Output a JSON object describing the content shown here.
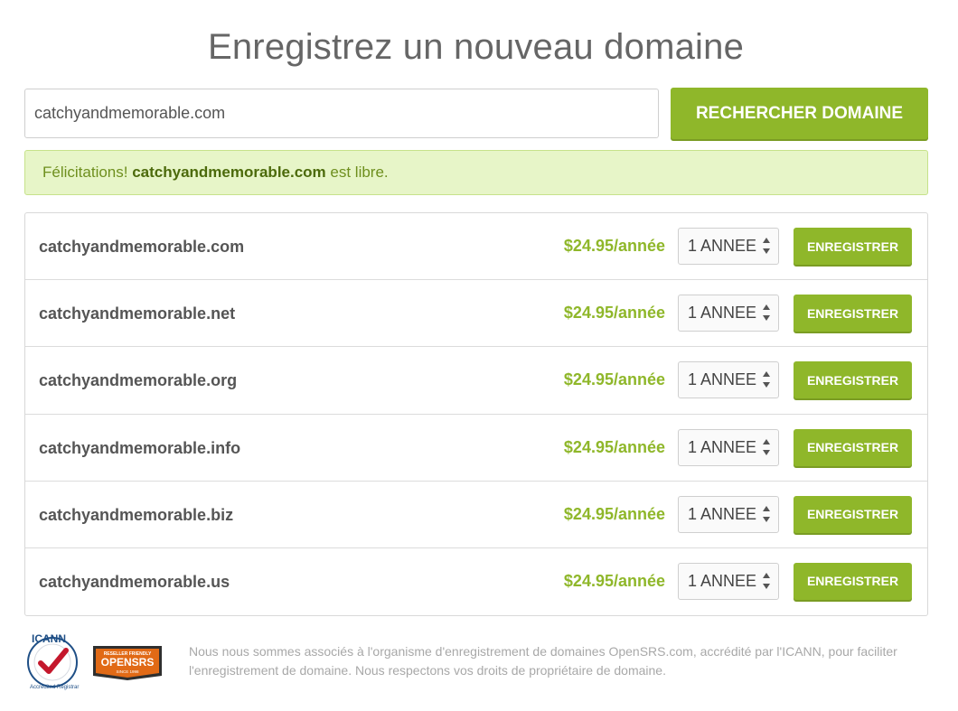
{
  "page": {
    "title": "Enregistrez un nouveau domaine"
  },
  "search": {
    "value": "catchyandmemorable.com",
    "button_label": "RECHERCHER DOMAINE"
  },
  "alert": {
    "prefix": "Félicitations! ",
    "domain": "catchyandmemorable.com",
    "suffix": " est libre."
  },
  "results": [
    {
      "domain": "catchyandmemorable.com",
      "price": "$24.95/année",
      "period": "1 ANNEE",
      "button_label": "ENREGISTRER"
    },
    {
      "domain": "catchyandmemorable.net",
      "price": "$24.95/année",
      "period": "1 ANNEE",
      "button_label": "ENREGISTRER"
    },
    {
      "domain": "catchyandmemorable.org",
      "price": "$24.95/année",
      "period": "1 ANNEE",
      "button_label": "ENREGISTRER"
    },
    {
      "domain": "catchyandmemorable.info",
      "price": "$24.95/année",
      "period": "1 ANNEE",
      "button_label": "ENREGISTRER"
    },
    {
      "domain": "catchyandmemorable.biz",
      "price": "$24.95/année",
      "period": "1 ANNEE",
      "button_label": "ENREGISTRER"
    },
    {
      "domain": "catchyandmemorable.us",
      "price": "$24.95/année",
      "period": "1 ANNEE",
      "button_label": "ENREGISTRER"
    }
  ],
  "footer": {
    "text": "Nous nous sommes associés à l'organisme d'enregistrement de domaines OpenSRS.com, accrédité par l'ICANN, pour faciliter l'enregistrement de domaine. Nous respectons vos droits de propriétaire de domaine.",
    "icann_logo": {
      "icon": "icann-accredited-registrar-logo",
      "text": "ICANN",
      "subtext": "Accredited Registrar"
    },
    "opensrs_logo": {
      "icon": "opensrs-logo",
      "text": "OPENSRS",
      "top_text": "RESELLER FRIENDLY",
      "bottom_text": "SINCE 1998"
    }
  },
  "colors": {
    "accent": "#8fb72a",
    "accent_shadow": "#7a9c23",
    "alert_bg": "#e7f5c8",
    "alert_border": "#c6e28a",
    "alert_text": "#6e8f1e",
    "text": "#555555",
    "footer_text": "#a8a8a8"
  }
}
